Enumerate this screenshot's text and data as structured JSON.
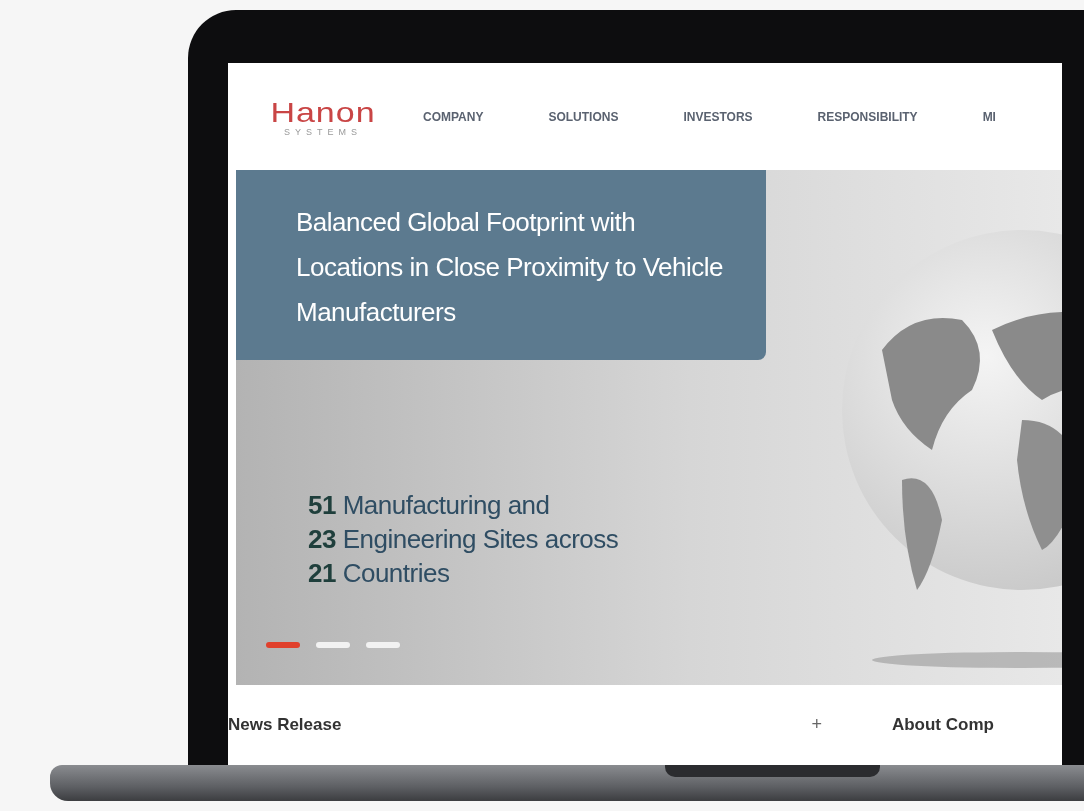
{
  "logo": {
    "name": "Hanon",
    "tagline": "SYSTEMS"
  },
  "nav": [
    {
      "label": "COMPANY"
    },
    {
      "label": "SOLUTIONS"
    },
    {
      "label": "INVESTORS"
    },
    {
      "label": "RESPONSIBILITY"
    },
    {
      "label": "MI"
    }
  ],
  "hero": {
    "title": "Balanced Global Footprint with Locations in Close Proximity to Vehicle Manufacturers",
    "stats": [
      "**51** Manufacturing and",
      "**23** Engineering Sites across",
      "**21** Countries"
    ],
    "slides": [
      {
        "selected": true
      },
      {
        "selected": false
      },
      {
        "selected": false
      }
    ]
  },
  "sections": [
    {
      "title": "News Release",
      "action": "+"
    },
    {
      "title": "About Comp"
    }
  ]
}
